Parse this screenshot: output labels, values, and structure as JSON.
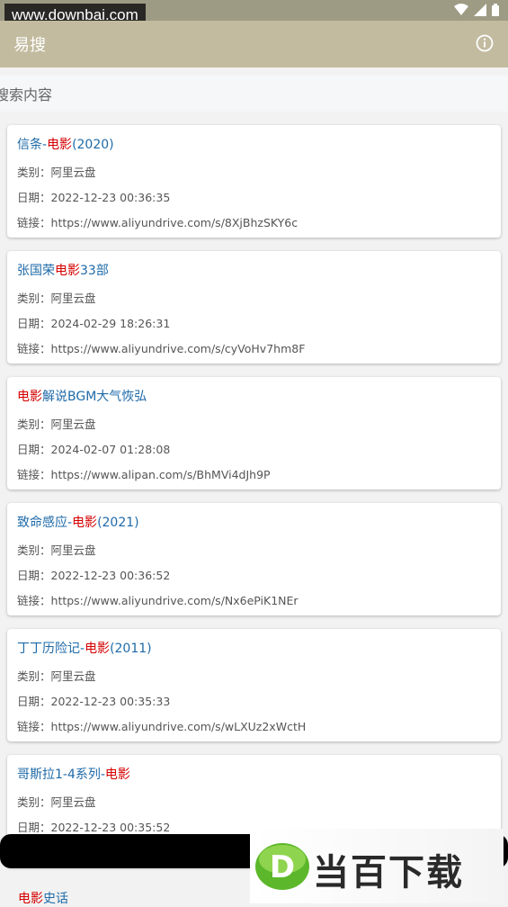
{
  "watermark_top": "www.downbai.com",
  "app": {
    "title": "易搜"
  },
  "search": {
    "placeholder": "搜索内容"
  },
  "labels": {
    "category": "类别：",
    "date": "日期：",
    "link": "链接："
  },
  "results": [
    {
      "title_pre": "信条-",
      "title_hl": "电影",
      "title_post": "(2020)",
      "category": "阿里云盘",
      "date": "2022-12-23 00:36:35",
      "link": "https://www.aliyundrive.com/s/8XjBhzSKY6c"
    },
    {
      "title_pre": "张国荣",
      "title_hl": "电影",
      "title_post": "33部",
      "category": "阿里云盘",
      "date": "2024-02-29 18:26:31",
      "link": "https://www.aliyundrive.com/s/cyVoHv7hm8F"
    },
    {
      "title_pre": "",
      "title_hl": "电影",
      "title_post": "解说BGM大气恢弘",
      "category": "阿里云盘",
      "date": "2024-02-07 01:28:08",
      "link": "https://www.alipan.com/s/BhMVi4dJh9P"
    },
    {
      "title_pre": "致命感应-",
      "title_hl": "电影",
      "title_post": "(2021)",
      "category": "阿里云盘",
      "date": "2022-12-23 00:36:52",
      "link": "https://www.aliyundrive.com/s/Nx6ePiK1NEr"
    },
    {
      "title_pre": "丁丁历险记-",
      "title_hl": "电影",
      "title_post": "(2011)",
      "category": "阿里云盘",
      "date": "2022-12-23 00:35:33",
      "link": "https://www.aliyundrive.com/s/wLXUz2xWctH"
    },
    {
      "title_pre": "哥斯拉1-4系列-",
      "title_hl": "电影",
      "title_post": "",
      "category": "阿里云盘",
      "date": "2022-12-23 00:35:52",
      "link": ""
    }
  ],
  "partial_result": {
    "title_hl": "电影",
    "title_post": "史话"
  },
  "brand": {
    "text": "当百下载",
    "logo_letter": "D"
  },
  "colors": {
    "appbar": "#c2bb9f",
    "title_blue": "#1e6aa8",
    "highlight_red": "#d40000"
  }
}
